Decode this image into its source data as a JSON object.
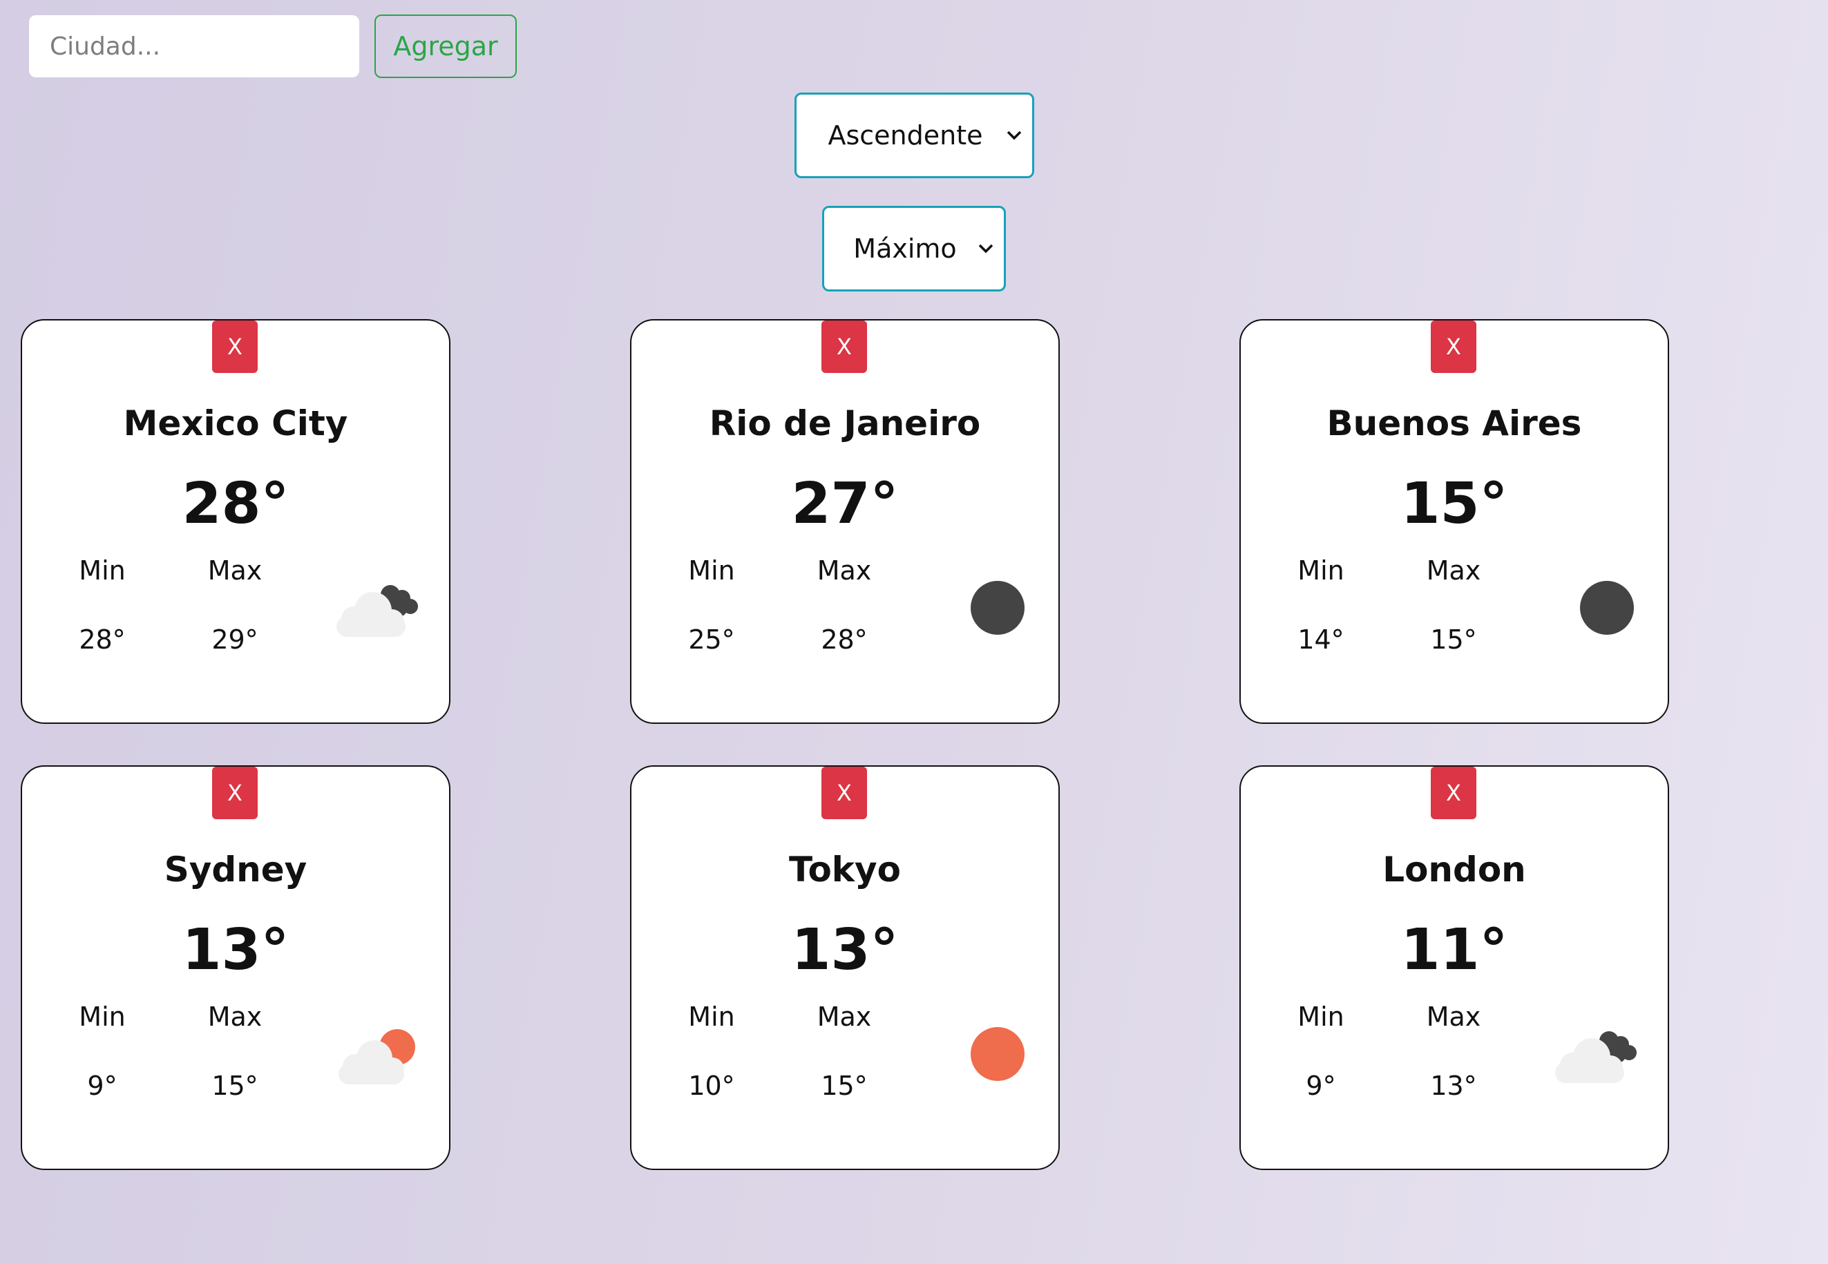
{
  "search": {
    "placeholder": "Ciudad...",
    "add_label": "Agregar"
  },
  "order_select": {
    "value": "Ascendente"
  },
  "type_select": {
    "value": "Máximo"
  },
  "colors": {
    "close": "#dc3545",
    "add": "#28a745",
    "select_border": "#17a2b8",
    "sun": "#ef6c4c",
    "moon": "#444444"
  },
  "cards": [
    {
      "close": "X",
      "city": "Mexico City",
      "temp": "28°",
      "min_label": "Min",
      "max_label": "Max",
      "min": "28°",
      "max": "29°",
      "icon": "cloudy-night-icon"
    },
    {
      "close": "X",
      "city": "Rio de Janeiro",
      "temp": "27°",
      "min_label": "Min",
      "max_label": "Max",
      "min": "25°",
      "max": "28°",
      "icon": "clear-night-icon"
    },
    {
      "close": "X",
      "city": "Buenos Aires",
      "temp": "15°",
      "min_label": "Min",
      "max_label": "Max",
      "min": "14°",
      "max": "15°",
      "icon": "clear-night-icon"
    },
    {
      "close": "X",
      "city": "Sydney",
      "temp": "13°",
      "min_label": "Min",
      "max_label": "Max",
      "min": "9°",
      "max": "15°",
      "icon": "partly-cloudy-day-icon"
    },
    {
      "close": "X",
      "city": "Tokyo",
      "temp": "13°",
      "min_label": "Min",
      "max_label": "Max",
      "min": "10°",
      "max": "15°",
      "icon": "sun-icon"
    },
    {
      "close": "X",
      "city": "London",
      "temp": "11°",
      "min_label": "Min",
      "max_label": "Max",
      "min": "9°",
      "max": "13°",
      "icon": "cloudy-night-icon"
    }
  ]
}
